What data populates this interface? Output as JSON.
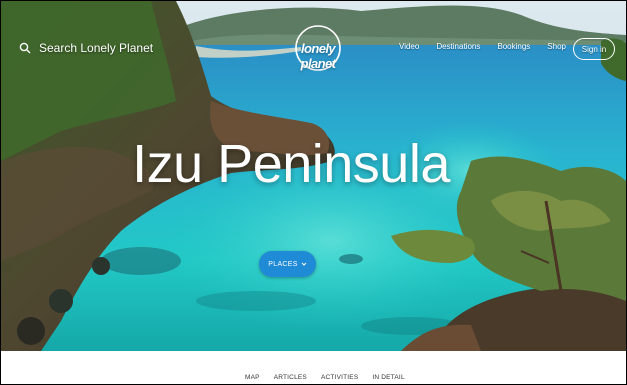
{
  "header": {
    "search_placeholder": "Search Lonely Planet",
    "logo_text": "lonely planet",
    "nav": [
      "Video",
      "Destinations",
      "Bookings",
      "Shop"
    ],
    "signin_label": "Sign in"
  },
  "hero": {
    "title": "Izu Peninsula",
    "places_button": "PLACES",
    "places_icon": "chevron-down-icon"
  },
  "subnav": {
    "items": [
      "MAP",
      "ARTICLES",
      "ACTIVITIES",
      "IN DETAIL"
    ]
  },
  "colors": {
    "accent": "#1f8ad6",
    "sea": "#1fc6cf",
    "text_on_image": "#ffffff"
  }
}
